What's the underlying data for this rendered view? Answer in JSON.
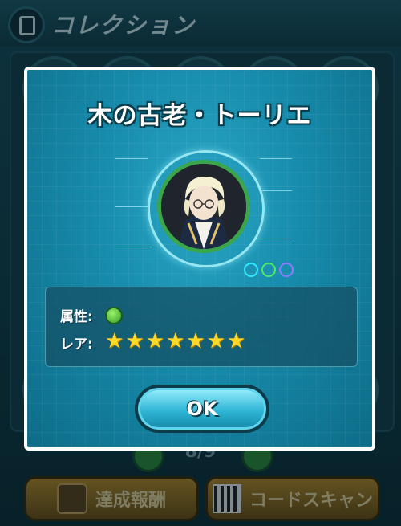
{
  "screen": {
    "title": "コレクション",
    "pager": "8/9",
    "buttons": {
      "achievement": "達成報酬",
      "code_scan": "コードスキャン"
    }
  },
  "dialog": {
    "title": "木の古老・トーリエ",
    "attribute_label": "属性:",
    "attribute_icon": "leaf-attribute-icon",
    "rarity_label": "レア:",
    "rarity_stars": 7,
    "ok_label": "OK",
    "colors": {
      "frame": "#ffffff",
      "panel": "#168aaa",
      "star": "#ffd92a",
      "ok": "#2fb6d6"
    }
  }
}
